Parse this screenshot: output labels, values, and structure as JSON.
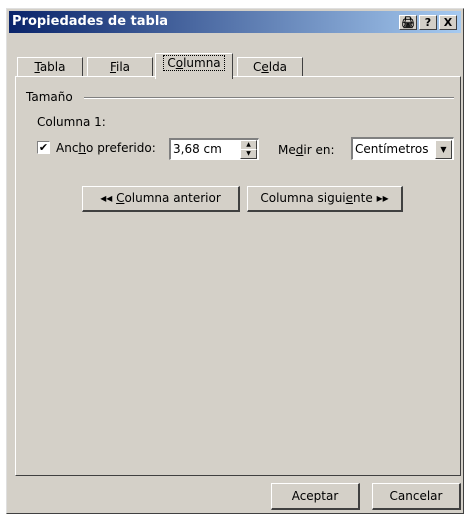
{
  "window": {
    "title": "Propiedades de tabla",
    "titlebar_buttons": [
      {
        "icon": "print-icon",
        "label": "🖨"
      },
      {
        "icon": "help-icon",
        "label": "?"
      },
      {
        "icon": "close-icon",
        "label": "X"
      }
    ]
  },
  "tabs": [
    {
      "pre": "",
      "accel": "T",
      "post": "abla"
    },
    {
      "pre": "",
      "accel": "F",
      "post": "ila"
    },
    {
      "pre": "C",
      "accel": "o",
      "post": "lumna"
    },
    {
      "pre": "C",
      "accel": "e",
      "post": "lda"
    }
  ],
  "active_tab": "Columna",
  "size_group": {
    "label": "Tamaño",
    "column_label": "Columna 1:",
    "preferred_width": {
      "checked": true,
      "check_mark": "✔",
      "pre": "Anc",
      "accel": "h",
      "post": "o preferido:",
      "value": "3,68 cm"
    },
    "measure": {
      "pre": "Me",
      "accel": "d",
      "post": "ir en:",
      "value": "Centímetros"
    }
  },
  "nav": {
    "prev": {
      "arrows": "◂◂",
      "pre": "",
      "accel": "C",
      "post": "olumna anterior"
    },
    "next": {
      "pre": "Columna sigui",
      "accel": "e",
      "post": "nte",
      "arrows": "▸▸"
    }
  },
  "footer": {
    "ok": "Aceptar",
    "cancel": "Cancelar"
  }
}
